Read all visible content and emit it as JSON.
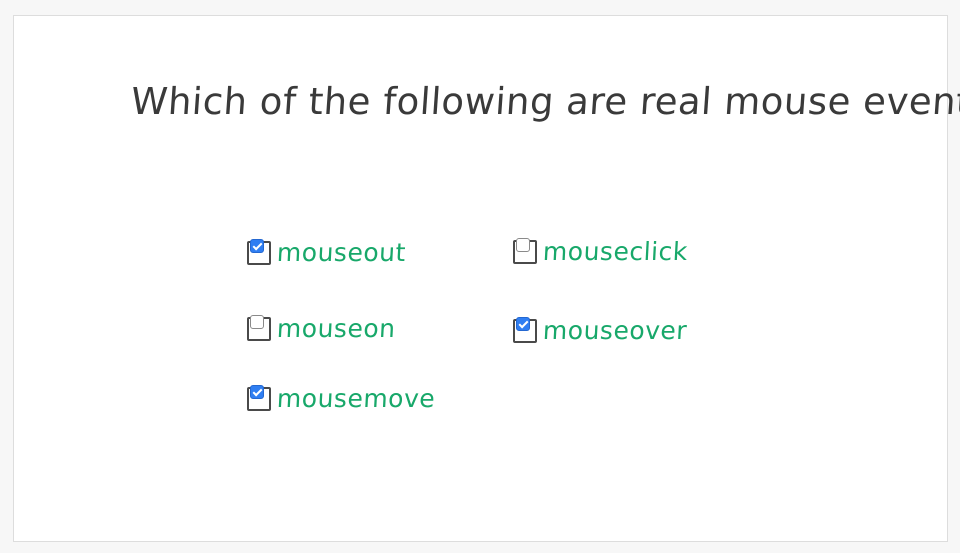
{
  "question": {
    "text": "Which of the following are real mouse events?"
  },
  "options": [
    {
      "label": "mouseout",
      "checked": true
    },
    {
      "label": "mouseclick",
      "checked": false
    },
    {
      "label": "mouseon",
      "checked": false
    },
    {
      "label": "mouseover",
      "checked": true
    },
    {
      "label": "mousemove",
      "checked": true
    }
  ],
  "colors": {
    "question_text": "#3a3a3a",
    "option_text": "#18a86a",
    "checkbox_checked": "#2f7ef2"
  }
}
